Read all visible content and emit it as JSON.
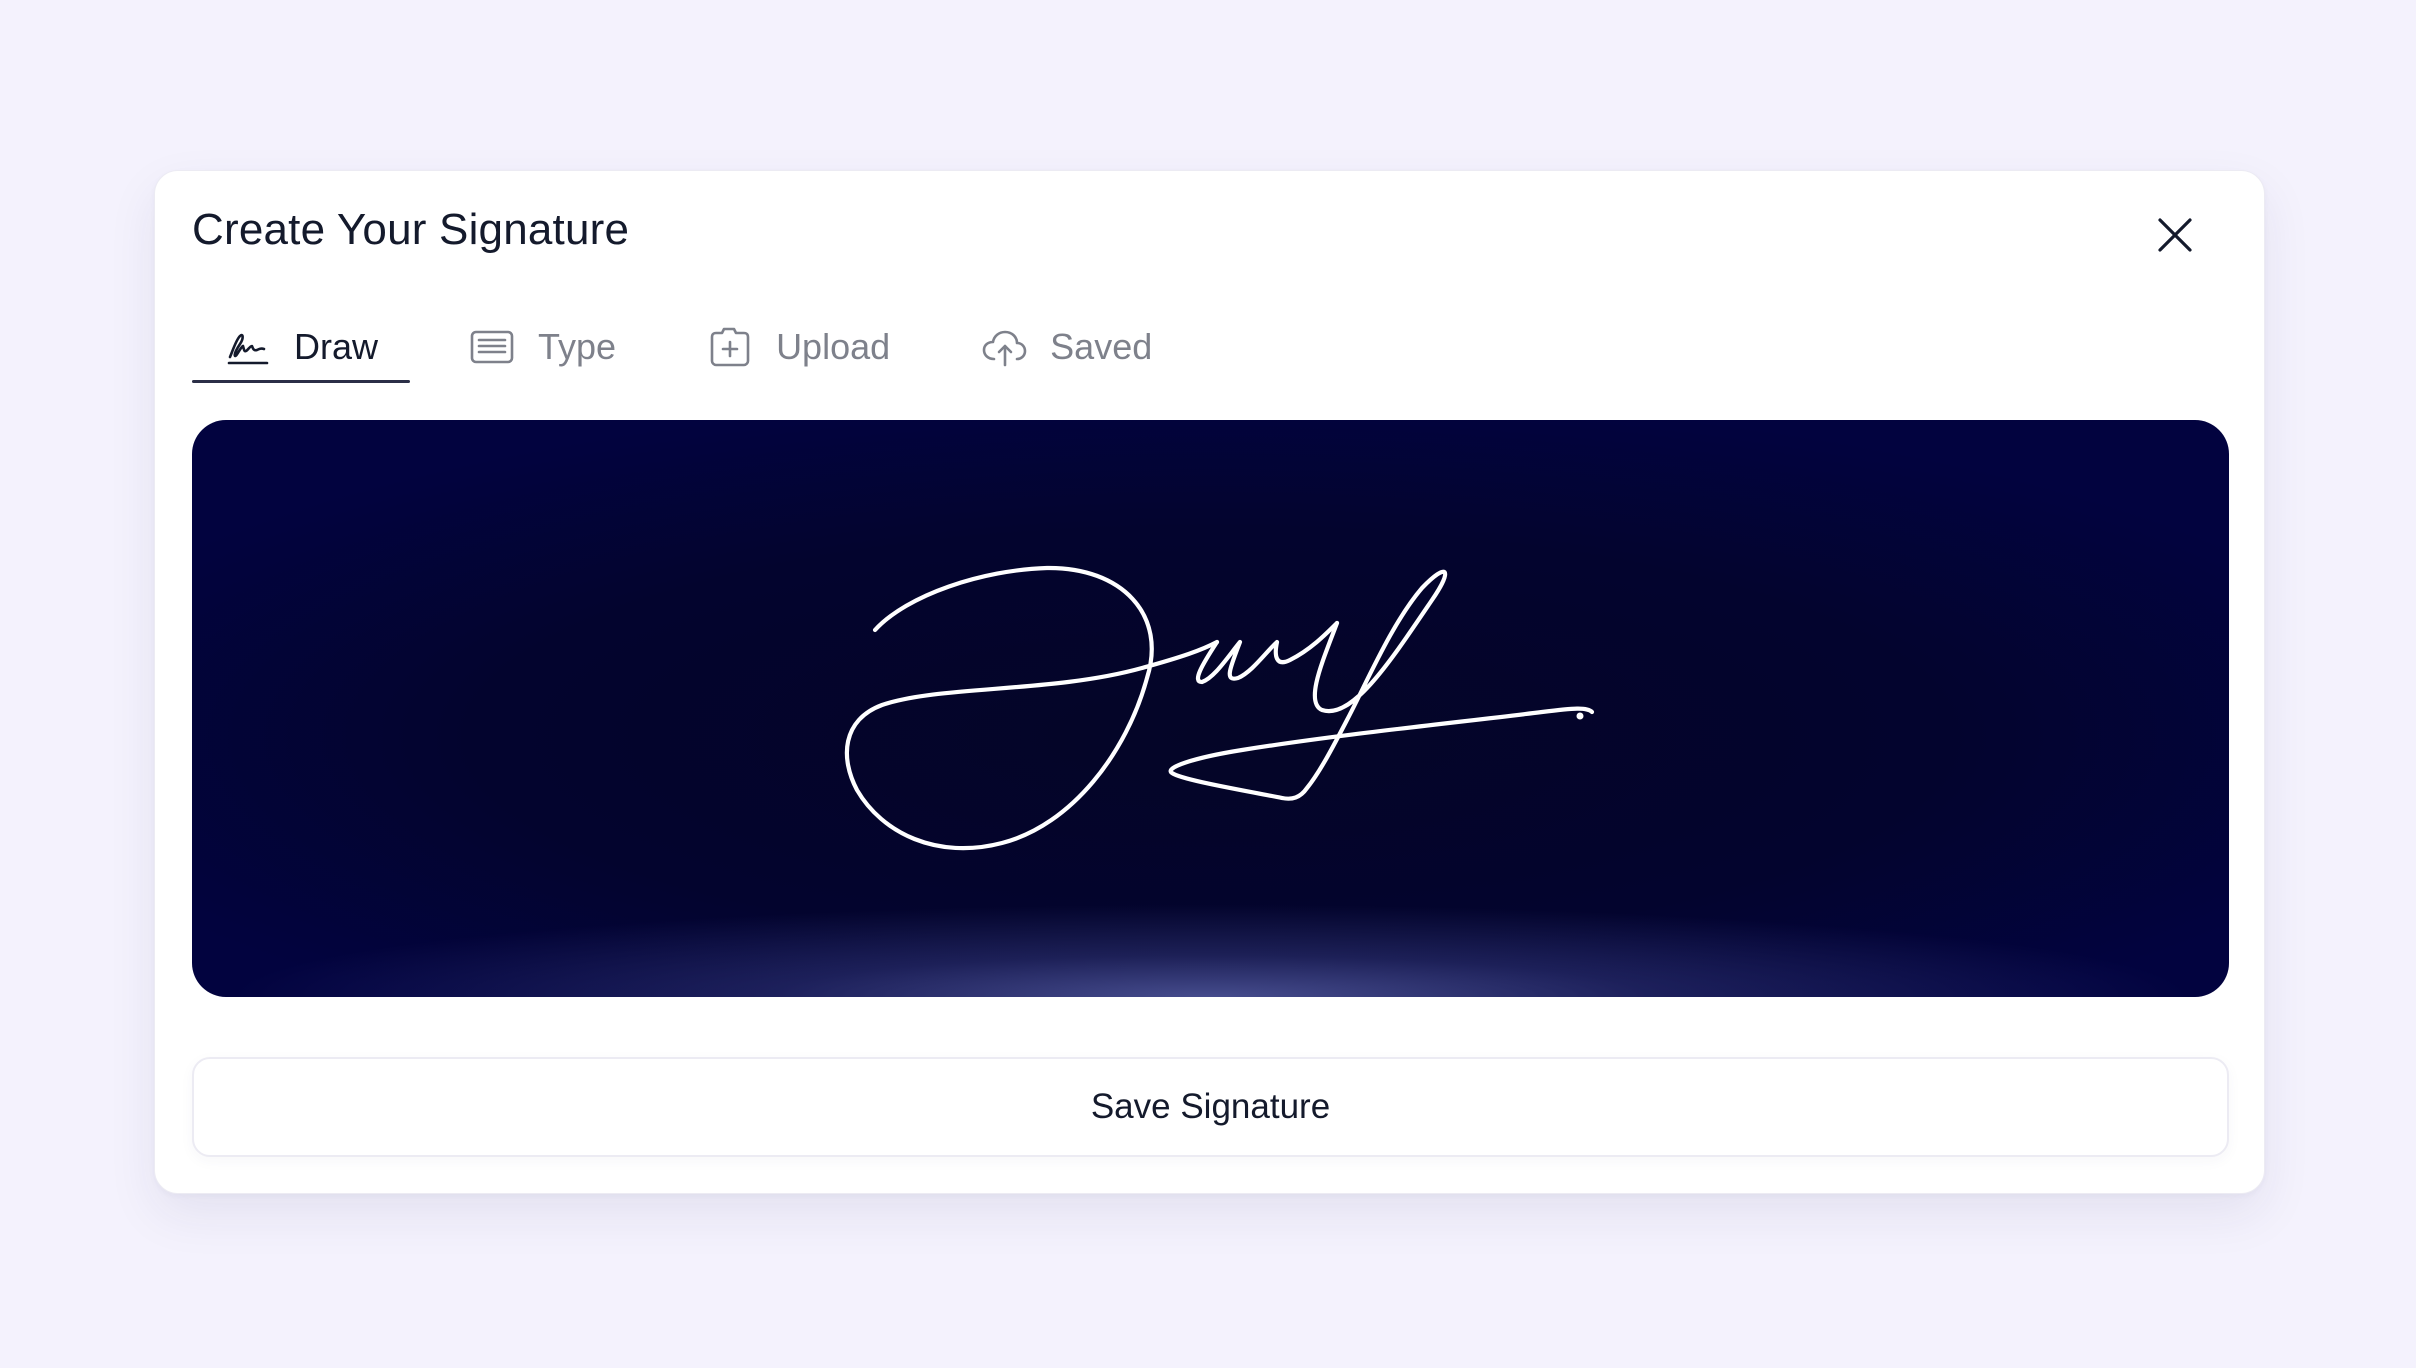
{
  "dialog": {
    "title": "Create Your Signature",
    "close_icon": "close-icon"
  },
  "tabs": [
    {
      "label": "Draw",
      "icon": "signature-pen-icon",
      "active": true
    },
    {
      "label": "Type",
      "icon": "keyboard-icon",
      "active": false
    },
    {
      "label": "Upload",
      "icon": "upload-folder-icon",
      "active": false
    },
    {
      "label": "Saved",
      "icon": "cloud-upload-icon",
      "active": false
    }
  ],
  "canvas": {
    "background_color": "#03042e",
    "stroke_color": "#ffffff"
  },
  "save_button": {
    "label": "Save Signature"
  },
  "colors": {
    "page_background": "#f4f2fd",
    "text_primary": "#141a2c",
    "text_muted": "#7e818b",
    "tab_underline": "#2b2f47"
  }
}
